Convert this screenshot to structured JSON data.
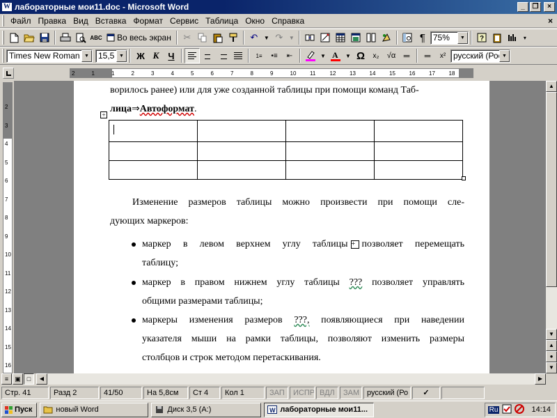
{
  "window": {
    "title": "лабораторные мои11.doc - Microsoft Word",
    "app_icon": "W",
    "minimize_label": "_",
    "maximize_label": "❐",
    "close_label": "×"
  },
  "menu": {
    "items": [
      "Файл",
      "Правка",
      "Вид",
      "Вставка",
      "Формат",
      "Сервис",
      "Таблица",
      "Окно",
      "Справка"
    ],
    "doc_close_label": "×"
  },
  "toolbar_standard": {
    "fullscreen_label": "Во весь экран",
    "zoom_value": "75%"
  },
  "toolbar_format": {
    "font_name": "Times New Roman",
    "font_size": "15,5",
    "bold_label": "Ж",
    "italic_label": "К",
    "underline_label": "Ч",
    "language_value": "русский (Росс"
  },
  "ruler": {
    "h_ticks": [
      "2",
      "1",
      "1",
      "2",
      "3",
      "4",
      "5",
      "6",
      "7",
      "8",
      "9",
      "10",
      "11",
      "12",
      "13",
      "14",
      "15",
      "16",
      "17",
      "18"
    ],
    "v_ticks": [
      "2",
      "3",
      "4",
      "5",
      "6",
      "7",
      "8",
      "9",
      "10",
      "11",
      "12",
      "13",
      "14",
      "15",
      "16"
    ]
  },
  "document": {
    "line1": "ворилось ранее) или для уже созданной таблицы при помощи команд Таб-",
    "line2_bold_pre": "лица",
    "line2_arrow": "⇒",
    "line2_bold_post": "Автоформат",
    "line2_end": ".",
    "para1_line1": "Изменение размеров таблицы можно произвести при помощи сле-",
    "para1_line2": "дующих маркеров:",
    "bullets": [
      {
        "line1_pre": "маркер в левом верхнем углу таблицы",
        "line1_post": "позволяет перемещать",
        "line2": "таблицу;"
      },
      {
        "line1_pre": "маркер в правом нижнем углу таблицы",
        "line1_mark": "???",
        "line1_post": "позволяет управлять",
        "line2": "общими размерами таблицы;"
      },
      {
        "line1_pre": "маркеры изменения размеров",
        "line1_mark": "???,",
        "line1_post": "появляющиеся при наведении",
        "line2": "указателя мыши на рамки таблицы, позволяют изменить размеры",
        "line3": "столбцов и строк методом перетаскивания."
      }
    ],
    "table": {
      "rows": 3,
      "cols": 4
    }
  },
  "statusbar": {
    "page": "Стр.  41",
    "section": "Разд  2",
    "pages": "41/50",
    "position": "На 5,8см",
    "line": "Ст  4",
    "column": "Кол  1",
    "rec": "ЗАП",
    "trk": "ИСПР",
    "ext": "ВДЛ",
    "ovr": "ЗАМ",
    "language": "русский (Ро"
  },
  "taskbar": {
    "start_label": "Пуск",
    "tasks": [
      {
        "label": "новый Word",
        "icon": "folder-icon"
      },
      {
        "label": "Диск 3,5 (A:)",
        "icon": "floppy-icon"
      },
      {
        "label": "лабораторные мои11...",
        "icon": "word-icon",
        "active": true
      }
    ],
    "tray_lang": "Ru",
    "clock": "14:14"
  },
  "colors": {
    "titlebar": "#0a246a",
    "face": "#d4d0c8",
    "highlight_bar": "#ff00ff",
    "font_color_bar": "#ff0000"
  }
}
